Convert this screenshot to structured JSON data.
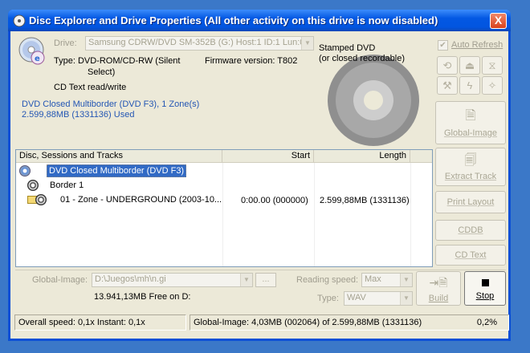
{
  "window": {
    "title": "Disc Explorer and Drive Properties (All other activity on this drive is now disabled)",
    "close_label": "X"
  },
  "drive": {
    "label": "Drive:",
    "value": "Samsung CDRW/DVD SM-352B (G:) Host:1 ID:1 Lun:0",
    "type_line1": "Type: DVD-ROM/CD-RW (Silent",
    "type_line2": "Select)",
    "firmware": "Firmware version: T802",
    "cdtext": "CD Text read/write",
    "summary_line1": "DVD Closed Multiborder (DVD F3), 1 Zone(s)",
    "summary_line2": "2.599,88MB (1331136) Used"
  },
  "disc_graphic": {
    "label_line1": "Stamped DVD",
    "label_line2": "(or closed recordable)"
  },
  "toolbar": {
    "auto_refresh_label": "Auto Refresh",
    "auto_refresh_checked": true,
    "icons": [
      "refresh-icon",
      "eject-icon",
      "load-icon",
      "tools-icon",
      "zap-icon",
      "magic-icon"
    ]
  },
  "side_buttons": {
    "global_image": "Global-Image",
    "extract_track": "Extract Track",
    "print_layout": "Print Layout",
    "cddb": "CDDB",
    "cd_text": "CD Text"
  },
  "tree": {
    "columns": [
      "Disc, Sessions and Tracks",
      "Start",
      "Length"
    ],
    "rows": [
      {
        "label": "DVD Closed Multiborder (DVD F3)",
        "start": "",
        "length": "",
        "selected": true
      },
      {
        "label": "Border 1",
        "start": "",
        "length": ""
      },
      {
        "label": "01 - Zone - UNDERGROUND  (2003-10...",
        "start": "0:00.00 (000000)",
        "length": "2.599,88MB (1331136)"
      }
    ]
  },
  "bottom": {
    "global_image_label": "Global-Image:",
    "global_image_path": "D:\\Juegos\\mh\\n.gi",
    "browse_label": "...",
    "free_space": "13.941,13MB Free on D:",
    "reading_speed_label": "Reading speed:",
    "reading_speed_value": "Max",
    "type_label": "Type:",
    "type_value": "WAV",
    "build_label": "Build",
    "stop_label": "Stop"
  },
  "status": {
    "overall": "Overall speed: 0,1x   Instant: 0,1x",
    "progress": "Global-Image: 4,03MB (002064) of 2.599,88MB (1331136)",
    "percent": "0,2%"
  }
}
